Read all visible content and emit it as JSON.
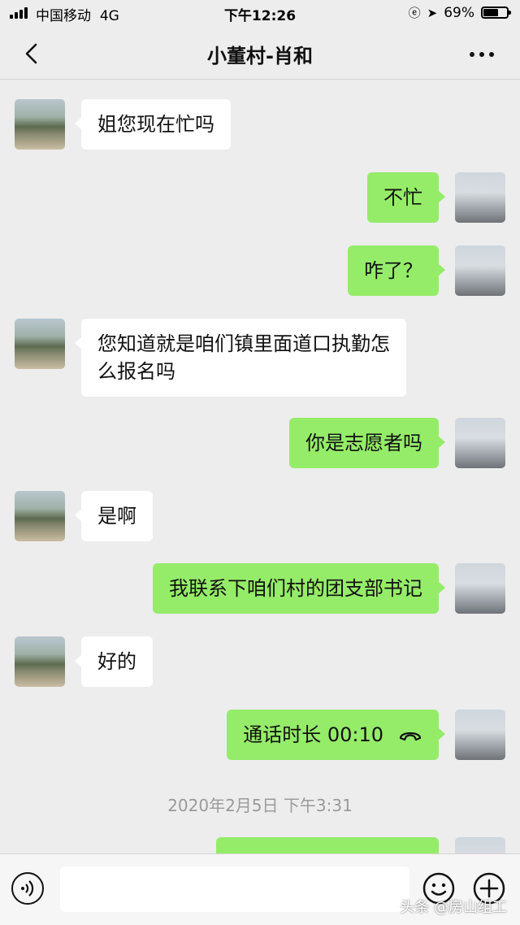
{
  "status_bar": {
    "carrier": "中国移动",
    "network": "4G",
    "time": "下午12:26",
    "battery_percent": "69%",
    "battery_level": 0.69
  },
  "nav": {
    "title": "小董村-肖和"
  },
  "messages": [
    {
      "side": "in",
      "text": "姐您现在忙吗"
    },
    {
      "side": "out",
      "text": "不忙"
    },
    {
      "side": "out",
      "text": "咋了？"
    },
    {
      "side": "in",
      "text_lines": [
        "您知道就是咱们镇里面道口执勤怎",
        "么报名吗"
      ]
    },
    {
      "side": "out",
      "text": "你是志愿者吗"
    },
    {
      "side": "in",
      "text": "是啊"
    },
    {
      "side": "out",
      "text": "我联系下咱们村的团支部书记"
    },
    {
      "side": "in",
      "text": "好的"
    },
    {
      "side": "out",
      "type": "call",
      "text": "通话时长 00:10"
    }
  ],
  "timestamp": "2020年2月5日 下午3:31",
  "watermark": "头条 @房山组工"
}
